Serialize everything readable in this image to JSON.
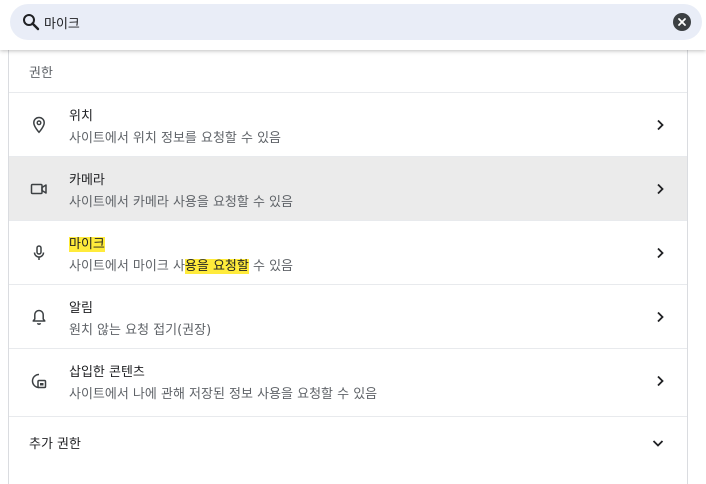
{
  "search": {
    "value": "마이크",
    "clear_icon": "close-circle-icon",
    "search_icon": "search-icon"
  },
  "section_title": "권한",
  "permissions": [
    {
      "title": "위치",
      "subtitle": "사이트에서 위치 정보를 요청할 수 있음",
      "icon": "location-pin-icon"
    },
    {
      "title": "카메라",
      "subtitle": "사이트에서 카메라 사용을 요청할 수 있음",
      "icon": "camera-icon"
    },
    {
      "title": "마이크",
      "subtitle_parts": [
        "사이트에서 마이크 사",
        "용을 요청할",
        " 수 있음"
      ],
      "icon": "microphone-icon"
    },
    {
      "title": "알림",
      "subtitle": "원치 않는 요청 접기(권장)",
      "icon": "bell-icon"
    },
    {
      "title": "삽입한 콘텐츠",
      "subtitle": "사이트에서 나에 관해 저장된 정보 사용을 요청할 수 있음",
      "icon": "embedded-content-icon"
    }
  ],
  "more_permissions": {
    "label": "추가 권한"
  },
  "colors": {
    "highlight": "#ffeb3b",
    "search_bg": "#e9edf7",
    "hover_row": "#ebebeb"
  }
}
